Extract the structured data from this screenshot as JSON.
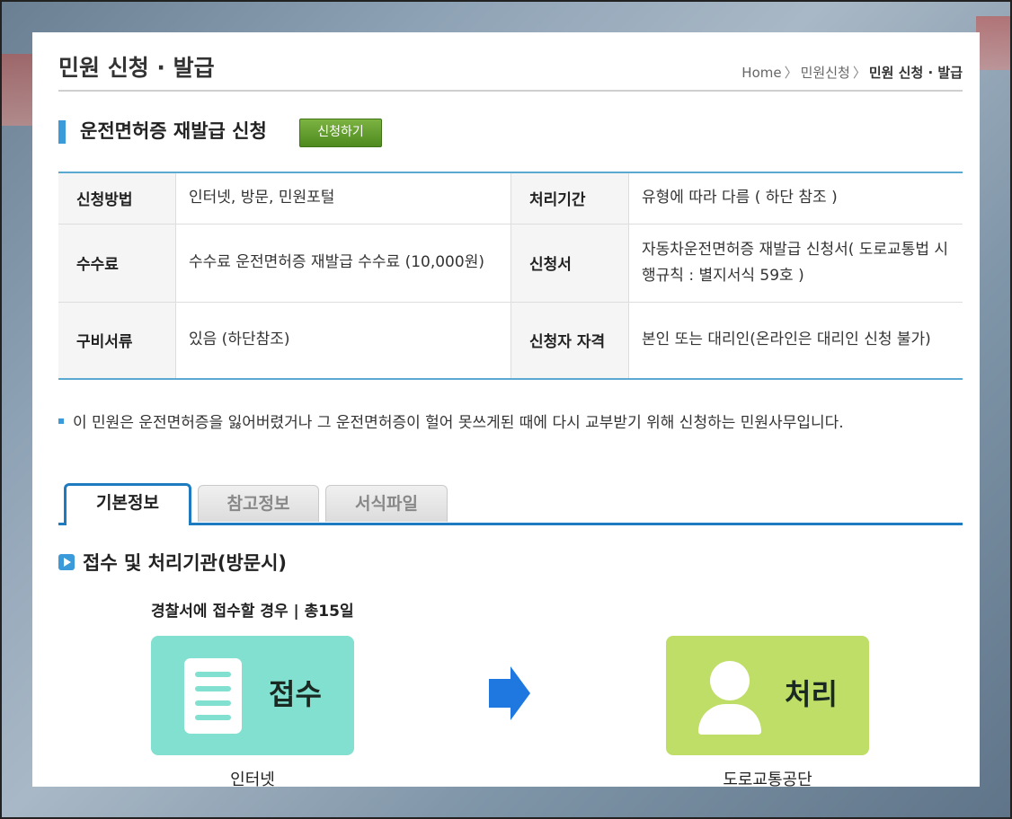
{
  "header": {
    "title": "민원 신청 · 발급",
    "breadcrumb": [
      "Home",
      "민원신청",
      "민원 신청 · 발급"
    ],
    "breadcrumb_sep": "〉"
  },
  "section": {
    "title": "운전면허증 재발급 신청",
    "apply_label": "신청하기"
  },
  "info_table": {
    "rows": [
      {
        "label1": "신청방법",
        "value1": "인터넷, 방문, 민원포털",
        "label2": "처리기간",
        "value2": "유형에 따라 다름 ( 하단 참조 )"
      },
      {
        "label1": "수수료",
        "value1": "수수료 운전면허증 재발급 수수료 (10,000원)",
        "label2": "신청서",
        "value2": "자동차운전면허증 재발급 신청서( 도로교통법 시행규칙 : 별지서식 59호 )"
      },
      {
        "label1": "구비서류",
        "value1": "있음 (하단참조)",
        "label2": "신청자 자격",
        "value2": "본인 또는 대리인(온라인은 대리인 신청 불가)"
      }
    ]
  },
  "description": "이 민원은 운전면허증을 잃어버렸거나 그 운전면허증이 헐어 못쓰게된 때에 다시 교부받기 위해 신청하는 민원사무입니다.",
  "tabs": [
    {
      "label": "기본정보",
      "active": true
    },
    {
      "label": "참고정보",
      "active": false
    },
    {
      "label": "서식파일",
      "active": false
    }
  ],
  "process": {
    "title": "접수 및 처리기관(방문시)",
    "case_label": "경찰서에 접수할 경우 | 총15일",
    "receive_label": "접수",
    "receive_caption": "인터넷",
    "process_label": "처리",
    "process_caption": "도로교통공단",
    "receive_icon": "document-icon",
    "process_icon": "person-icon",
    "arrow_icon": "arrow-right-icon"
  },
  "colors": {
    "accent": "#3b9ad9",
    "tab_border": "#1e7bc0",
    "apply_button": "#5c9a2a",
    "receive_box": "#82e0d0",
    "process_box": "#bede67",
    "arrow": "#1f78e0"
  }
}
